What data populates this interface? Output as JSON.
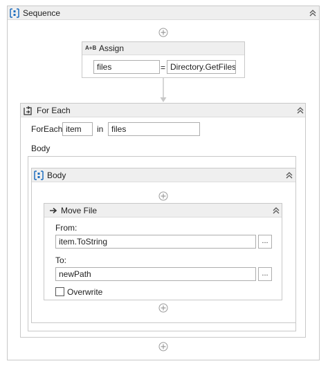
{
  "sequence": {
    "title": "Sequence"
  },
  "assign": {
    "title": "Assign",
    "icon_text": "A+B",
    "to_value": "files",
    "equals": "=",
    "value": "Directory.GetFiles(t"
  },
  "foreach": {
    "title": "For Each",
    "foreach_label": "ForEach",
    "item_value": "item",
    "in_label": "in",
    "collection_value": "files",
    "body_label": "Body"
  },
  "body": {
    "title": "Body"
  },
  "movefile": {
    "title": "Move File",
    "from_label": "From:",
    "from_value": "item.ToString",
    "to_label": "To:",
    "to_value": "newPath",
    "browse_label": "...",
    "overwrite_label": "Overwrite",
    "overwrite_checked": false
  },
  "colors": {
    "accent": "#1f6fbf",
    "header": "#efefef",
    "border": "#c8c8c8",
    "connector": "#c8c8c8"
  },
  "icons": {
    "sequence": "sequence-icon",
    "assign": "assign-icon",
    "foreach": "foreach-icon",
    "movefile": "move-arrow-icon",
    "collapse": "double-chevron-up-icon",
    "add": "plus-circle-icon"
  }
}
